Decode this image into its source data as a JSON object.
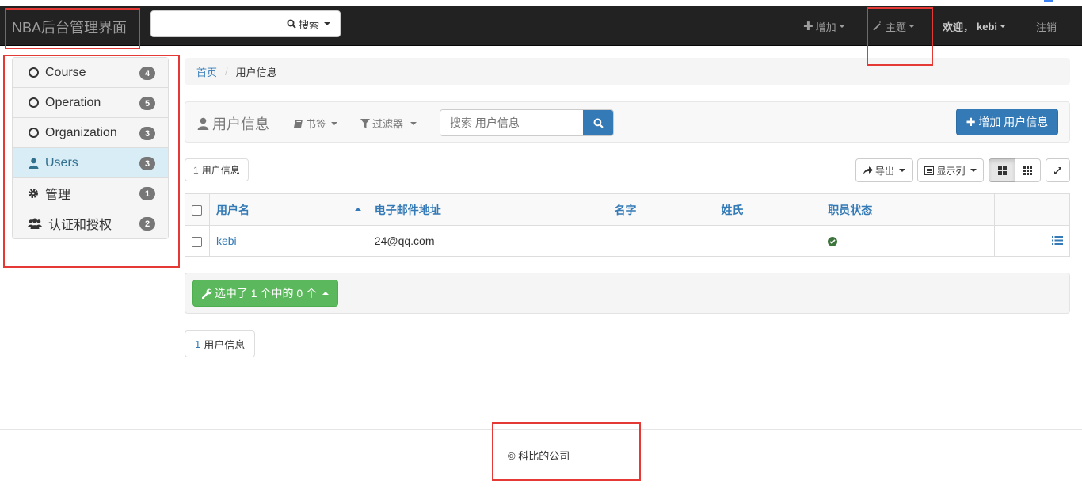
{
  "navbar": {
    "brand": "NBA后台管理界面",
    "search_button": "搜索",
    "add_menu": "增加",
    "theme_menu": "主题",
    "welcome_prefix": "欢迎，",
    "username": "kebi",
    "logout": "注销"
  },
  "sidebar": {
    "items": [
      {
        "label": "Course",
        "badge": "4",
        "icon": "circle-outline-icon"
      },
      {
        "label": "Operation",
        "badge": "5",
        "icon": "circle-outline-icon"
      },
      {
        "label": "Organization",
        "badge": "3",
        "icon": "circle-outline-icon"
      },
      {
        "label": "Users",
        "badge": "3",
        "icon": "user-icon",
        "active": true
      },
      {
        "label": "管理",
        "badge": "1",
        "icon": "gear-icon"
      },
      {
        "label": "认证和授权",
        "badge": "2",
        "icon": "group-icon"
      }
    ]
  },
  "breadcrumb": {
    "home": "首页",
    "current": "用户信息"
  },
  "panel": {
    "title": "用户信息",
    "bookmarks": "书签",
    "filters": "过滤器",
    "search_placeholder": "搜索 用户信息",
    "add_button": "增加 用户信息"
  },
  "result_count": {
    "number": "1",
    "label": "用户信息"
  },
  "toolbar": {
    "export": "导出",
    "columns": "显示列"
  },
  "table": {
    "headers": [
      "用户名",
      "电子邮件地址",
      "名字",
      "姓氏",
      "职员状态"
    ],
    "rows": [
      {
        "username": "kebi",
        "email": "24@qq.com",
        "first_name": "",
        "last_name": "",
        "is_staff": true
      }
    ]
  },
  "action_button": "选中了 1 个中的 0 个",
  "footer": {
    "copyright": "© 科比的公司"
  },
  "colors": {
    "primary": "#337ab7",
    "success": "#5cb85c",
    "navbar": "#222222",
    "highlight_box": "#e53935"
  }
}
